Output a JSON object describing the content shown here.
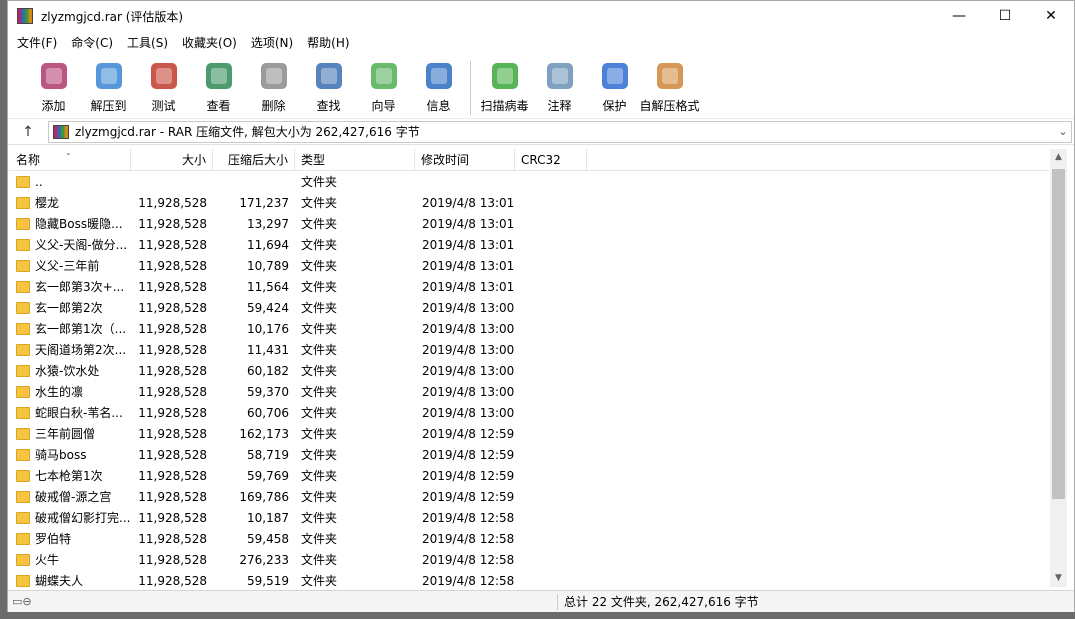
{
  "window": {
    "title": "zlyzmgjcd.rar (评估版本)"
  },
  "controls": {
    "minimize": "—",
    "maximize": "☐",
    "close": "✕"
  },
  "menu": [
    "文件(F)",
    "命令(C)",
    "工具(S)",
    "收藏夹(O)",
    "选项(N)",
    "帮助(H)"
  ],
  "toolbar": [
    {
      "label": "添加",
      "icon": "add-archive-icon",
      "color": "#b03a6f"
    },
    {
      "label": "解压到",
      "icon": "extract-folder-icon",
      "color": "#3a86d4"
    },
    {
      "label": "测试",
      "icon": "test-clipboard-icon",
      "color": "#c0392b"
    },
    {
      "label": "查看",
      "icon": "view-book-icon",
      "color": "#2e8b57"
    },
    {
      "label": "删除",
      "icon": "trash-icon",
      "color": "#8a8a8a"
    },
    {
      "label": "查找",
      "icon": "find-magnifier-icon",
      "color": "#3a6fb0"
    },
    {
      "label": "向导",
      "icon": "wizard-wand-icon",
      "color": "#4caf50"
    },
    {
      "label": "信息",
      "icon": "info-icon",
      "color": "#2d6cc0"
    },
    {
      "label": "扫描病毒",
      "icon": "virus-scan-icon",
      "color": "#3aa83a"
    },
    {
      "label": "注释",
      "icon": "comment-icon",
      "color": "#6a8fb5"
    },
    {
      "label": "保护",
      "icon": "shield-icon",
      "color": "#2f6bd1"
    },
    {
      "label": "自解压格式",
      "icon": "sfx-box-icon",
      "color": "#d0853a"
    }
  ],
  "address": {
    "text": "zlyzmgjcd.rar - RAR 压缩文件, 解包大小为 262,427,616 字节"
  },
  "columns": {
    "name": "名称",
    "size": "大小",
    "packed": "压缩后大小",
    "type": "类型",
    "modified": "修改时间",
    "crc": "CRC32"
  },
  "rows": [
    {
      "name": "..",
      "size": "",
      "packed": "",
      "type": "文件夹",
      "modified": ""
    },
    {
      "name": "樱龙",
      "size": "11,928,528",
      "packed": "171,237",
      "type": "文件夹",
      "modified": "2019/4/8 13:01"
    },
    {
      "name": "隐藏Boss暖隐...",
      "size": "11,928,528",
      "packed": "13,297",
      "type": "文件夹",
      "modified": "2019/4/8 13:01"
    },
    {
      "name": "义父-天阁-做分...",
      "size": "11,928,528",
      "packed": "11,694",
      "type": "文件夹",
      "modified": "2019/4/8 13:01"
    },
    {
      "name": "义父-三年前",
      "size": "11,928,528",
      "packed": "10,789",
      "type": "文件夹",
      "modified": "2019/4/8 13:01"
    },
    {
      "name": "玄一郎第3次+...",
      "size": "11,928,528",
      "packed": "11,564",
      "type": "文件夹",
      "modified": "2019/4/8 13:01"
    },
    {
      "name": "玄一郎第2次",
      "size": "11,928,528",
      "packed": "59,424",
      "type": "文件夹",
      "modified": "2019/4/8 13:00"
    },
    {
      "name": "玄一郎第1次（...",
      "size": "11,928,528",
      "packed": "10,176",
      "type": "文件夹",
      "modified": "2019/4/8 13:00"
    },
    {
      "name": "天阁道场第2次...",
      "size": "11,928,528",
      "packed": "11,431",
      "type": "文件夹",
      "modified": "2019/4/8 13:00"
    },
    {
      "name": "水猿-饮水处",
      "size": "11,928,528",
      "packed": "60,182",
      "type": "文件夹",
      "modified": "2019/4/8 13:00"
    },
    {
      "name": "水生的凛",
      "size": "11,928,528",
      "packed": "59,370",
      "type": "文件夹",
      "modified": "2019/4/8 13:00"
    },
    {
      "name": "蛇眼白秋-苇名...",
      "size": "11,928,528",
      "packed": "60,706",
      "type": "文件夹",
      "modified": "2019/4/8 13:00"
    },
    {
      "name": "三年前圆僧",
      "size": "11,928,528",
      "packed": "162,173",
      "type": "文件夹",
      "modified": "2019/4/8 12:59"
    },
    {
      "name": "骑马boss",
      "size": "11,928,528",
      "packed": "58,719",
      "type": "文件夹",
      "modified": "2019/4/8 12:59"
    },
    {
      "name": "七本枪第1次",
      "size": "11,928,528",
      "packed": "59,769",
      "type": "文件夹",
      "modified": "2019/4/8 12:59"
    },
    {
      "name": "破戒僧-源之宫",
      "size": "11,928,528",
      "packed": "169,786",
      "type": "文件夹",
      "modified": "2019/4/8 12:59"
    },
    {
      "name": "破戒僧幻影打完...",
      "size": "11,928,528",
      "packed": "10,187",
      "type": "文件夹",
      "modified": "2019/4/8 12:58"
    },
    {
      "name": "罗伯特",
      "size": "11,928,528",
      "packed": "59,458",
      "type": "文件夹",
      "modified": "2019/4/8 12:58"
    },
    {
      "name": "火牛",
      "size": "11,928,528",
      "packed": "276,233",
      "type": "文件夹",
      "modified": "2019/4/8 12:58"
    },
    {
      "name": "蝴蝶夫人",
      "size": "11,928,528",
      "packed": "59,519",
      "type": "文件夹",
      "modified": "2019/4/8 12:58"
    }
  ],
  "status": {
    "summary": "总计 22 文件夹, 262,427,616 字节"
  }
}
